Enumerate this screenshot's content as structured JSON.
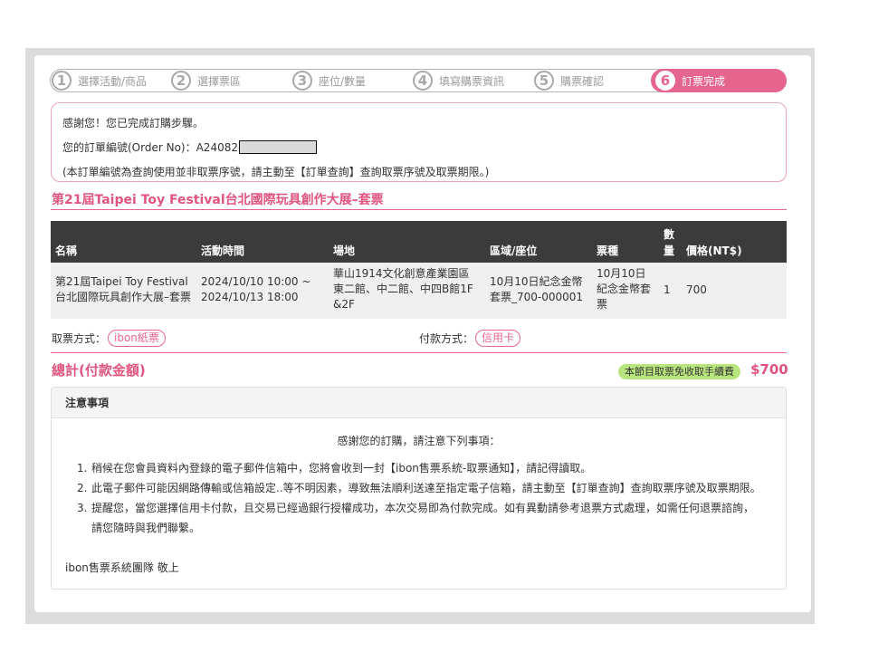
{
  "steps": [
    {
      "num": "1",
      "label": "選擇活動/商品"
    },
    {
      "num": "2",
      "label": "選擇票區"
    },
    {
      "num": "3",
      "label": "座位/數量"
    },
    {
      "num": "4",
      "label": "填寫購票資訊"
    },
    {
      "num": "5",
      "label": "購票確認"
    },
    {
      "num": "6",
      "label": "訂票完成"
    }
  ],
  "thanks": {
    "line1": "感謝您！您已完成訂購步驟。",
    "order_label": "您的訂單編號(Order No)：A24082",
    "line3": "(本訂單編號為查詢使用並非取票序號，請主動至【訂單查詢】查詢取票序號及取票期限。)"
  },
  "event_title": "第21屆Taipei Toy Festival台北國際玩具創作大展–套票",
  "table": {
    "headers": {
      "name": "名稱",
      "time": "活動時間",
      "venue": "場地",
      "area": "區域/座位",
      "type": "票種",
      "qty_top": "數",
      "qty_bottom": "量",
      "price": "價格(NT$)"
    },
    "row": {
      "name_1": "第21屆Taipei Toy Festival",
      "name_2": "台北國際玩具創作大展–套票",
      "time_1": "2024/10/10 10:00 ~",
      "time_2": "2024/10/13 18:00",
      "venue_1": "華山1914文化創意產業園區",
      "venue_2": "東二館、中二館、中四B館1F",
      "venue_3": "&2F",
      "area_1": "10月10日紀念金幣",
      "area_2": "套票_700-000001",
      "type_1": "10月10日",
      "type_2": "紀念金幣套",
      "type_3": "票",
      "qty": "1",
      "price": "700"
    }
  },
  "pickup": {
    "label": "取票方式：",
    "value": "ibon紙票"
  },
  "payment": {
    "label": "付款方式：",
    "value": "信用卡"
  },
  "total": {
    "label": "總計(付款金額)",
    "fee_note": "本節目取票免收取手續費",
    "amount": "$700"
  },
  "notice": {
    "title": "注意事項",
    "intro": "感謝您的訂購，請注意下列事項：",
    "items": [
      {
        "n": "1.",
        "text": "稍候在您會員資料內登錄的電子郵件信箱中，您將會收到一封【ibon售票系統-取票通知】，請記得讀取。"
      },
      {
        "n": "2.",
        "text": "此電子郵件可能因網路傳輸或信箱設定..等不明因素，導致無法順利送達至指定電子信箱，請主動至【訂單查詢】查詢取票序號及取票期限。"
      },
      {
        "n": "3.",
        "text": "提醒您，當您選擇信用卡付款，且交易已經過銀行授權成功，本次交易即為付款完成。如有異動請參考退票方式處理，如需任何退票諮詢，",
        "text2": "請您隨時與我們聯繫。"
      }
    ],
    "signature": "ibon售票系統團隊 敬上"
  },
  "colors": {
    "accent": "#e6658f",
    "table_header": "#3b3b3b",
    "fee_badge": "#b8e57e"
  }
}
